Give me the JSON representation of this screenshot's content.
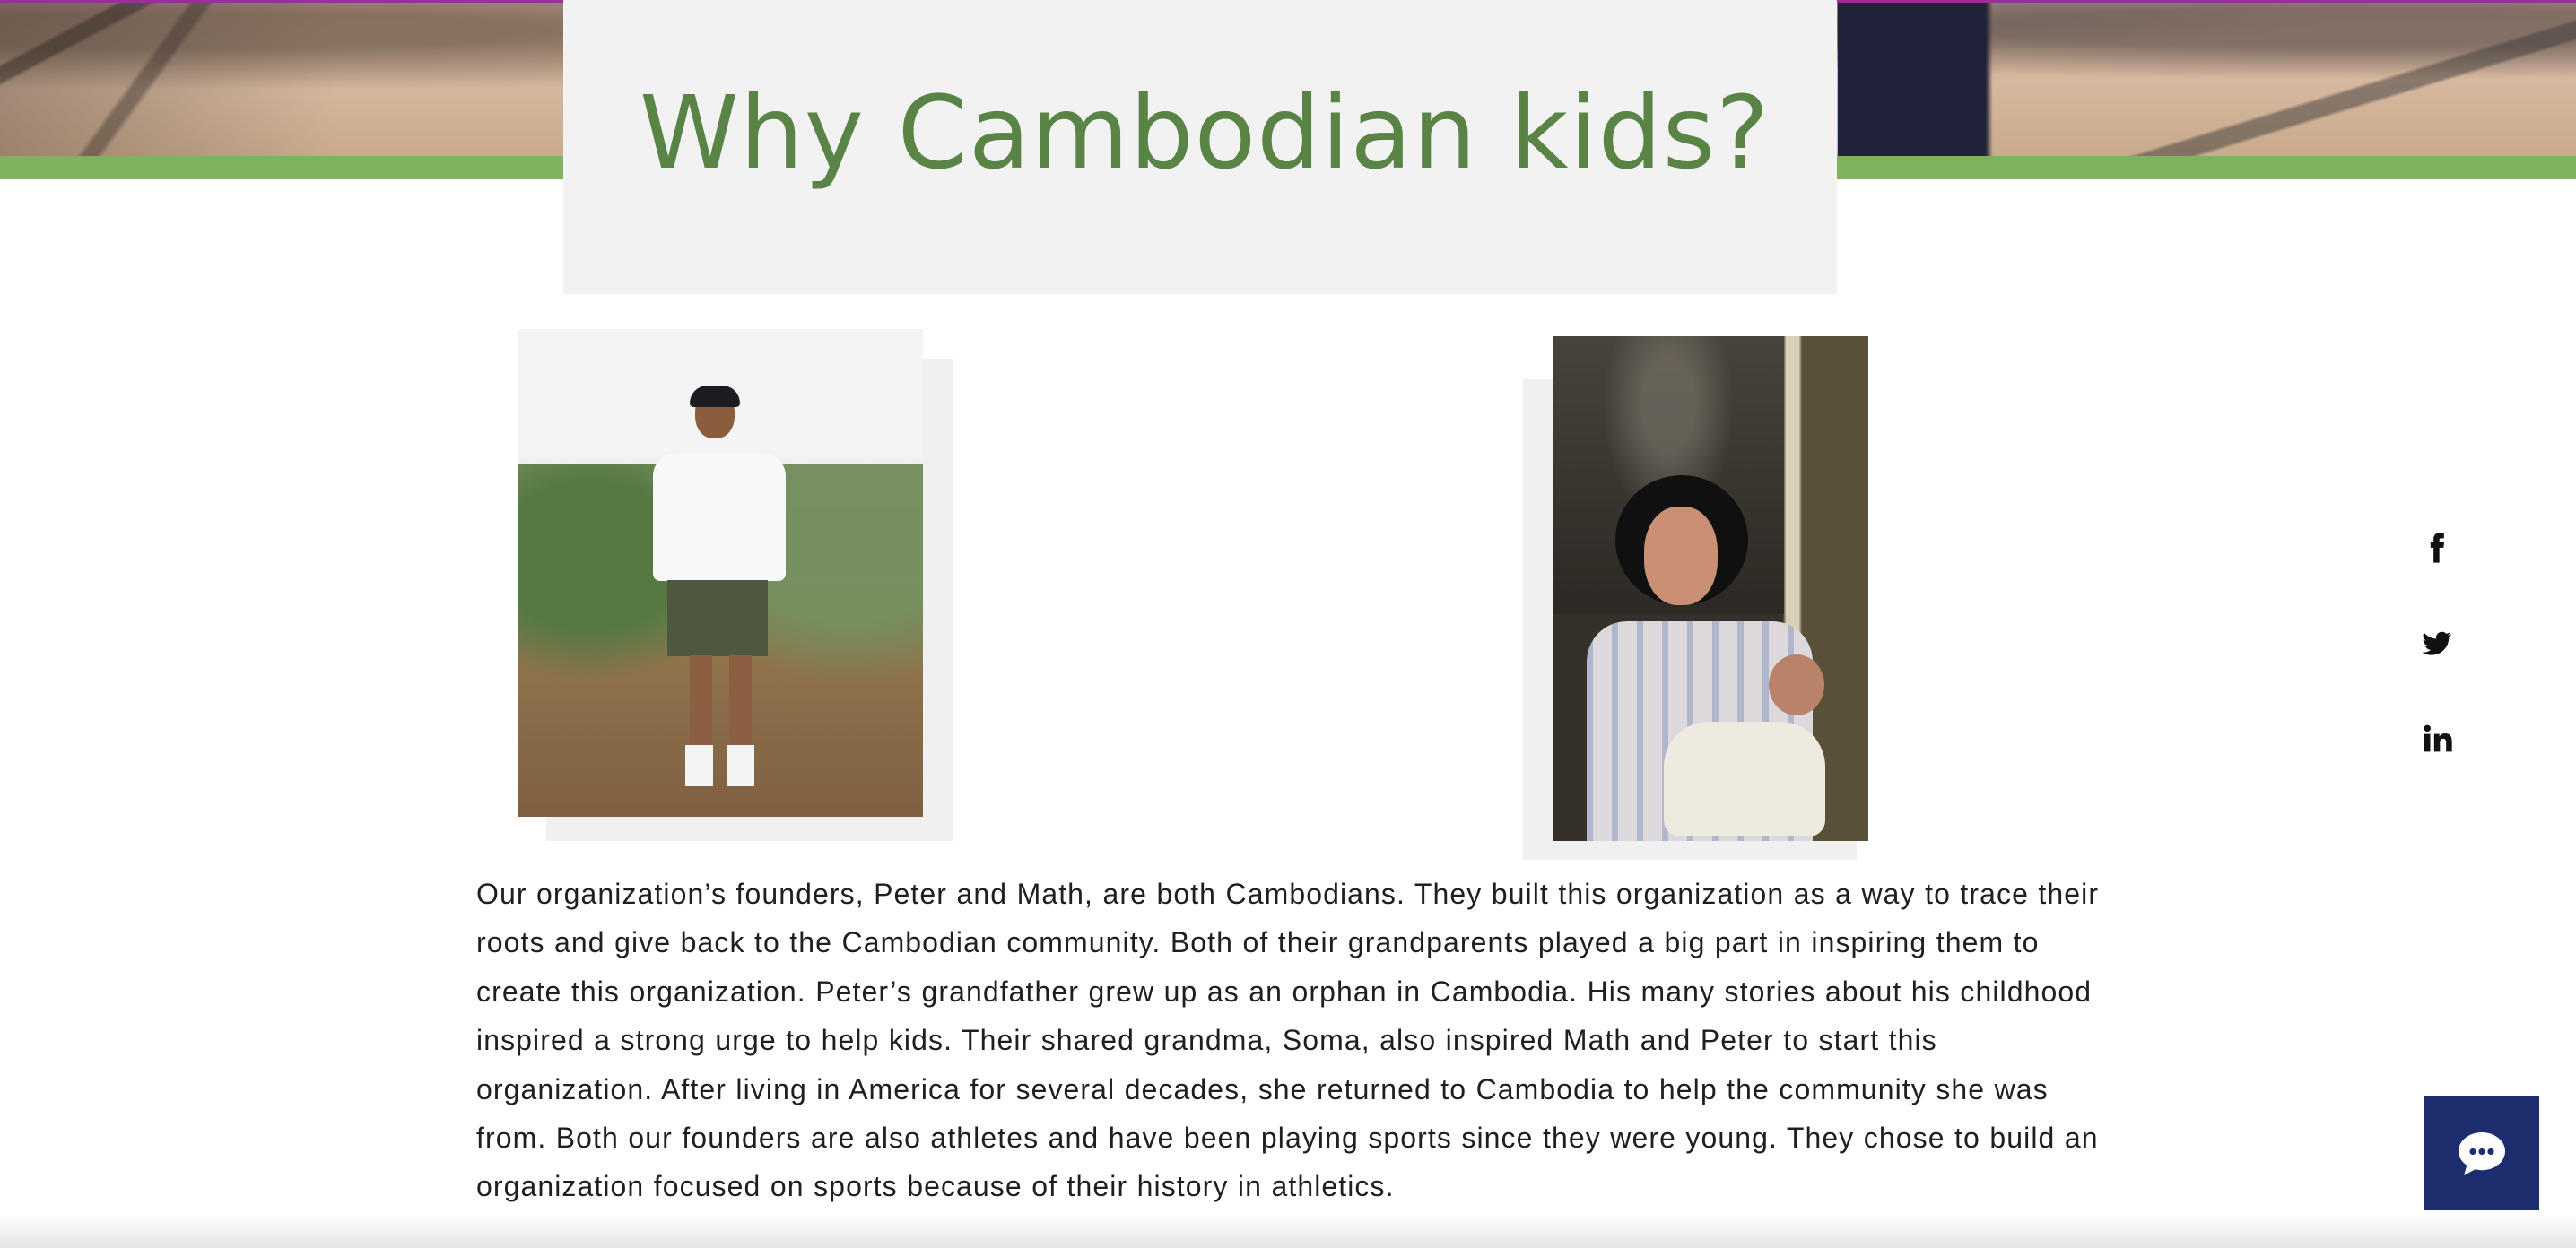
{
  "main": {
    "title": "Why Cambodian kids?",
    "body_text": "Our organization’s founders, Peter and Math, are both Cambodians. They built this organization as a way to trace their roots and give back to the Cambodian community. Both of their grandparents played a big part in inspiring them to create this organization. Peter’s grandfather grew up as an orphan in Cambodia. His many stories about his childhood inspired a strong urge to help kids. Their shared grandma, Soma, also inspired Math and Peter to start this organization. After living in America for several decades, she returned to Cambodia to help the community she was from. Both our founders are also athletes and have been playing sports since they were young. They chose to build an organization focused on sports because of their history in athletics."
  },
  "social": {
    "icons": [
      "facebook-icon",
      "twitter-icon",
      "linkedin-icon"
    ]
  },
  "chat": {
    "icon": "chat-bubble-icon"
  },
  "colors": {
    "title_green": "#5a8446",
    "band_green": "#7fb25f",
    "title_box": "#f2f2f2",
    "chat_blue": "#1d2d6e",
    "text": "#1f1f1f",
    "purple_line": "#9c2f96"
  }
}
